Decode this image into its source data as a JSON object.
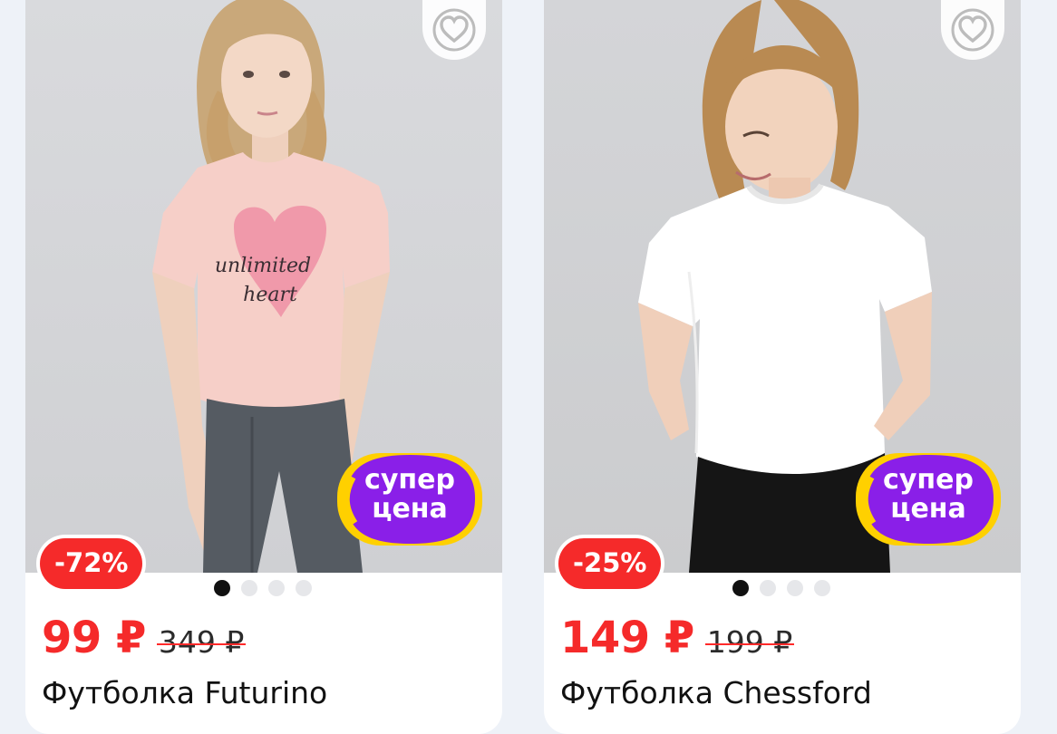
{
  "products": [
    {
      "discount": "-72%",
      "price": "99 ₽",
      "old_price": "349 ₽",
      "title": "Футболка Futurino",
      "badge": {
        "line1": "супер",
        "line2": "цена"
      },
      "shirt_print": {
        "line1": "unlimited",
        "line2": "heart"
      },
      "shirt_color": "#f6cfc8",
      "heart_print_color": "#ee8fa4"
    },
    {
      "discount": "-25%",
      "price": "149 ₽",
      "old_price": "199 ₽",
      "title": "Футболка Chessford",
      "badge": {
        "line1": "супер",
        "line2": "цена"
      },
      "shirt_color": "#ffffff"
    }
  ],
  "colors": {
    "accent_red": "#f52a2a",
    "badge_purple": "#8a1fe8",
    "badge_yellow": "#ffd000",
    "page_background": "#eef2f8"
  },
  "icons": {
    "favorite": "heart-outline-icon"
  }
}
